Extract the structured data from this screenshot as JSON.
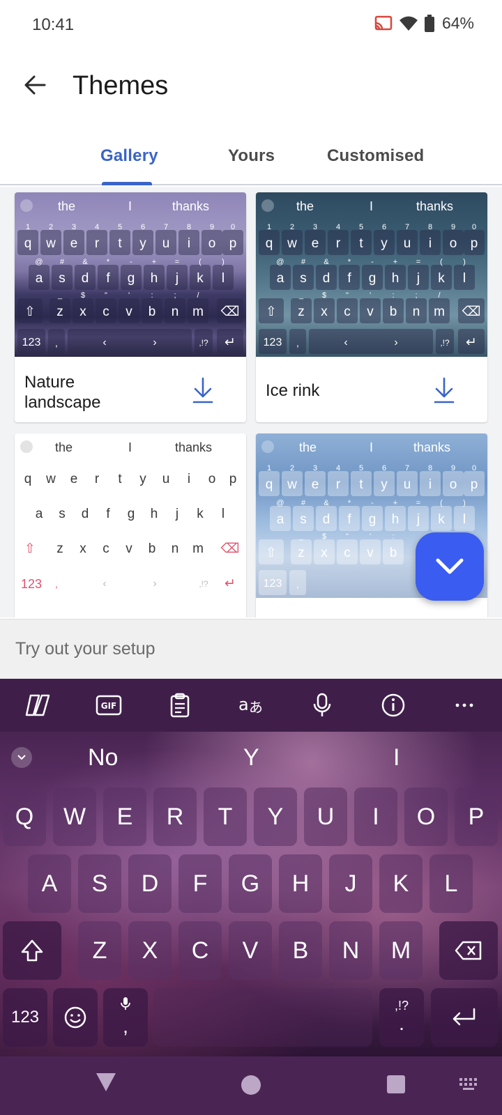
{
  "status": {
    "time": "10:41",
    "battery": "64%"
  },
  "header": {
    "title": "Themes"
  },
  "tabs": [
    {
      "label": "Gallery",
      "active": true
    },
    {
      "label": "Yours",
      "active": false
    },
    {
      "label": "Customised",
      "active": false
    }
  ],
  "gallery": {
    "cards": [
      {
        "name": "Nature landscape",
        "suggestions": [
          "the",
          "I",
          "thanks"
        ]
      },
      {
        "name": "Ice rink",
        "suggestions": [
          "the",
          "I",
          "thanks"
        ]
      },
      {
        "name": "",
        "suggestions": [
          "the",
          "I",
          "thanks"
        ]
      },
      {
        "name": "",
        "suggestions": [
          "the",
          "I",
          "thanks"
        ]
      }
    ],
    "mini_keys": {
      "row1": [
        "q",
        "w",
        "e",
        "r",
        "t",
        "y",
        "u",
        "i",
        "o",
        "p"
      ],
      "row1_nums": [
        "1",
        "2",
        "3",
        "4",
        "5",
        "6",
        "7",
        "8",
        "9",
        "0"
      ],
      "row2": [
        "a",
        "s",
        "d",
        "f",
        "g",
        "h",
        "j",
        "k",
        "l"
      ],
      "row2_subs": [
        "@",
        "#",
        "&",
        "*",
        "-",
        "+",
        "=",
        "(",
        ")"
      ],
      "row3": [
        "z",
        "x",
        "c",
        "v",
        "b",
        "n",
        "m"
      ],
      "row3_subs": [
        "_",
        "$",
        "\"",
        "'",
        ":",
        ";",
        "/"
      ],
      "num_key": "123",
      "punct": ",!?"
    }
  },
  "tryout": {
    "placeholder": "Try out your setup"
  },
  "keyboard": {
    "suggestions": [
      "No",
      "Y",
      "I"
    ],
    "row1": [
      "Q",
      "W",
      "E",
      "R",
      "T",
      "Y",
      "U",
      "I",
      "O",
      "P"
    ],
    "row2": [
      "A",
      "S",
      "D",
      "F",
      "G",
      "H",
      "J",
      "K",
      "L"
    ],
    "row3": [
      "Z",
      "X",
      "C",
      "V",
      "B",
      "N",
      "M"
    ],
    "num_key": "123",
    "comma": ",",
    "period": ".",
    "punct_hint": ",!?",
    "toolbar_icons": [
      "copilot-icon",
      "gif-icon",
      "clipboard-icon",
      "translate-icon",
      "microphone-icon",
      "info-icon",
      "more-icon"
    ]
  },
  "colors": {
    "accent": "#3a64c8",
    "fab": "#3a5cf0",
    "keyboard_bg": "#4a2554"
  }
}
